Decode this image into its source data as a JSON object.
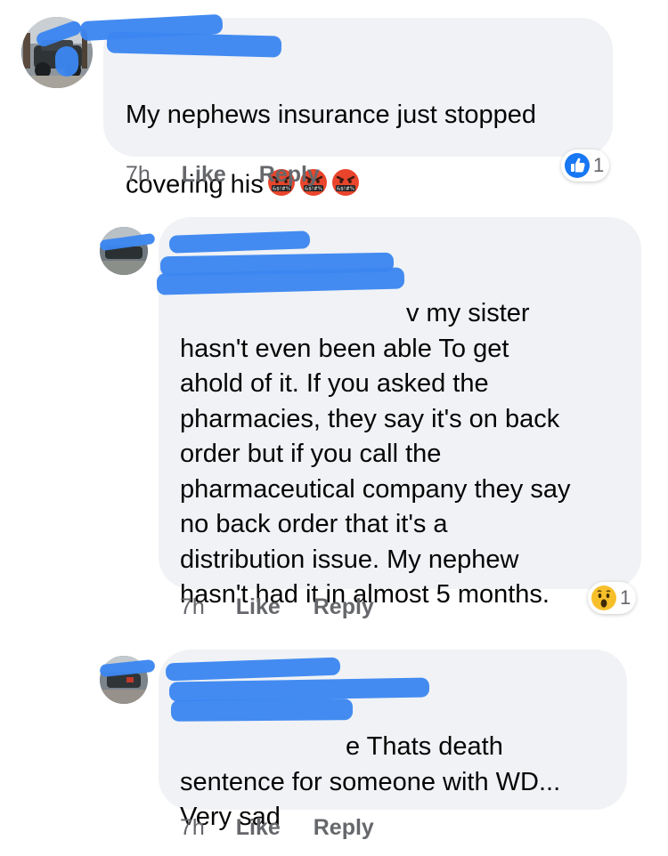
{
  "comments": [
    {
      "text": "My nephews insurance just stopped\ncovering his",
      "time": "7h",
      "like_label": "Like",
      "reply_label": "Reply",
      "reaction": {
        "icon": "like-icon",
        "count": "1"
      },
      "emoji": [
        "cursing-face",
        "cursing-face",
        "cursing-face"
      ],
      "emoji_symbol": "&$!#%"
    },
    {
      "text_first": "v my sister",
      "text": "hasn't even been able  To get\nahold of it. If you asked the\npharmacies, they say it's on back\norder but if you call the\npharmaceutical company they say\nno back order that it's a\ndistribution issue. My nephew\nhasn't had it in almost 5 months.",
      "time": "7h",
      "like_label": "Like",
      "reply_label": "Reply",
      "reaction": {
        "icon": "wow-icon",
        "count": "1"
      }
    },
    {
      "text_first": "e Thats death",
      "text": "sentence for someone with WD...\nVery sad",
      "time": "7h",
      "like_label": "Like",
      "reply_label": "Reply"
    }
  ],
  "colors": {
    "bubble": "#f0f2f5",
    "redaction": "#3b86f0",
    "meta": "#65676b",
    "like_blue": "#1877f2"
  }
}
